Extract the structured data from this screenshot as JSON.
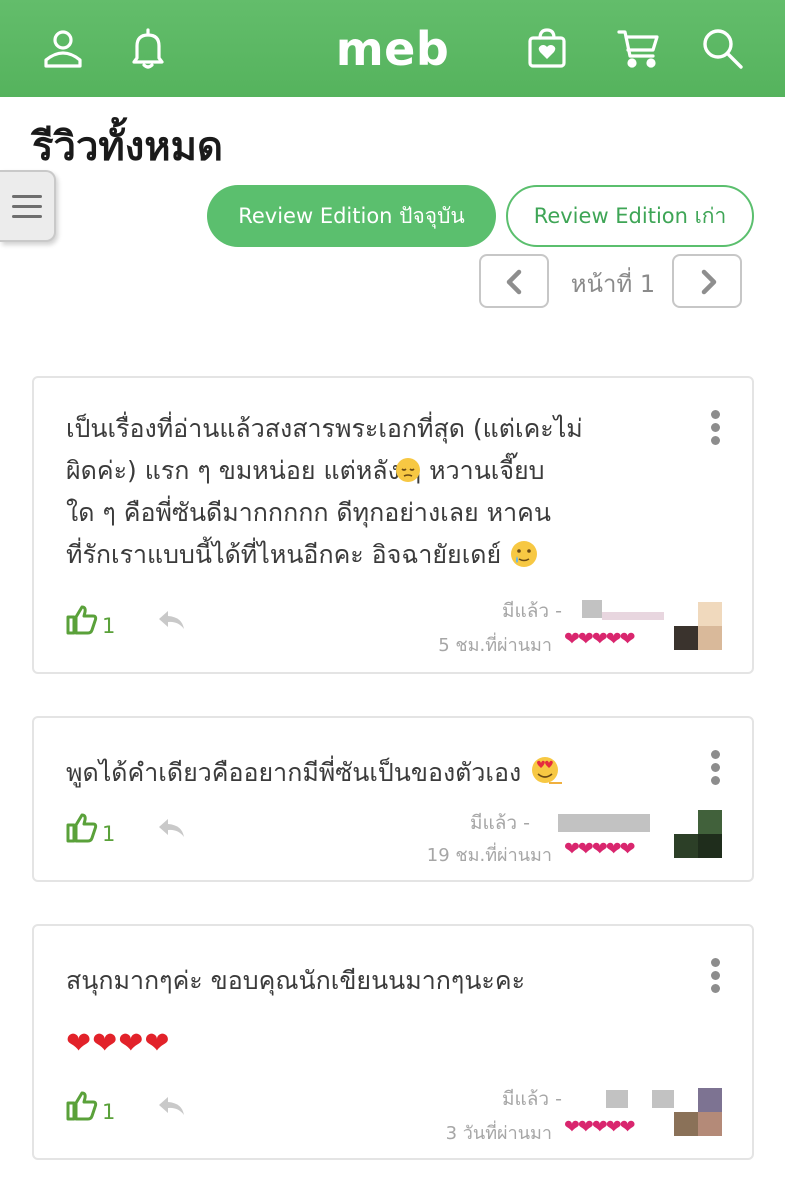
{
  "header": {
    "brand": "meb",
    "icons": [
      "user-icon",
      "bell-icon",
      "wishlist-bag-icon",
      "cart-icon",
      "search-icon"
    ],
    "color": "#5cb964"
  },
  "page": {
    "title": "รีวิวทั้งหมด"
  },
  "sidebar_toggle": {
    "icon": "hamburger-icon"
  },
  "tabs": [
    {
      "label": "Review Edition ปัจจุบัน",
      "active": true
    },
    {
      "label": "Review Edition เก่า",
      "active": false
    }
  ],
  "pager": {
    "label": "หน้าที่ 1"
  },
  "reviews": [
    {
      "text_lines": [
        "เป็นเรื่องที่อ่านแล้วสงสารพระเอกที่สุด (แต่เคะไม่",
        "ผิดค่ะ) แรก ๆ ขมหน่อย แต่หลัง ๆ หวานเจี๊ยบ",
        "ใด ๆ คือพี่ซันดีมากกกกก ดีทุกอย่างเลย หาคน",
        "ที่รักเราแบบนี้ได้ที่ไหนอีกคะ อิจฉายัยเดย์"
      ],
      "likes": "1",
      "status": "มีแล้ว -",
      "time": "5 ชม.ที่ผ่านมา",
      "rating": 5
    },
    {
      "text_lines": [
        "พูดได้คำเดียวคืออยากมีพี่ซันเป็นของตัวเอง"
      ],
      "likes": "1",
      "status": "มีแล้ว -",
      "time": "19 ชม.ที่ผ่านมา",
      "rating": 5
    },
    {
      "text_lines": [
        "สนุกมากๆค่ะ ขอบคุณนักเขียนนมากๆนะคะ"
      ],
      "extra": "❤❤❤❤",
      "likes": "1",
      "status": "มีแล้ว -",
      "time": "3 วันที่ผ่านมา",
      "rating": 5
    }
  ],
  "accent_colors": {
    "green": "#5bbf6e",
    "heart": "#d9266e",
    "like": "#5aa13a"
  }
}
